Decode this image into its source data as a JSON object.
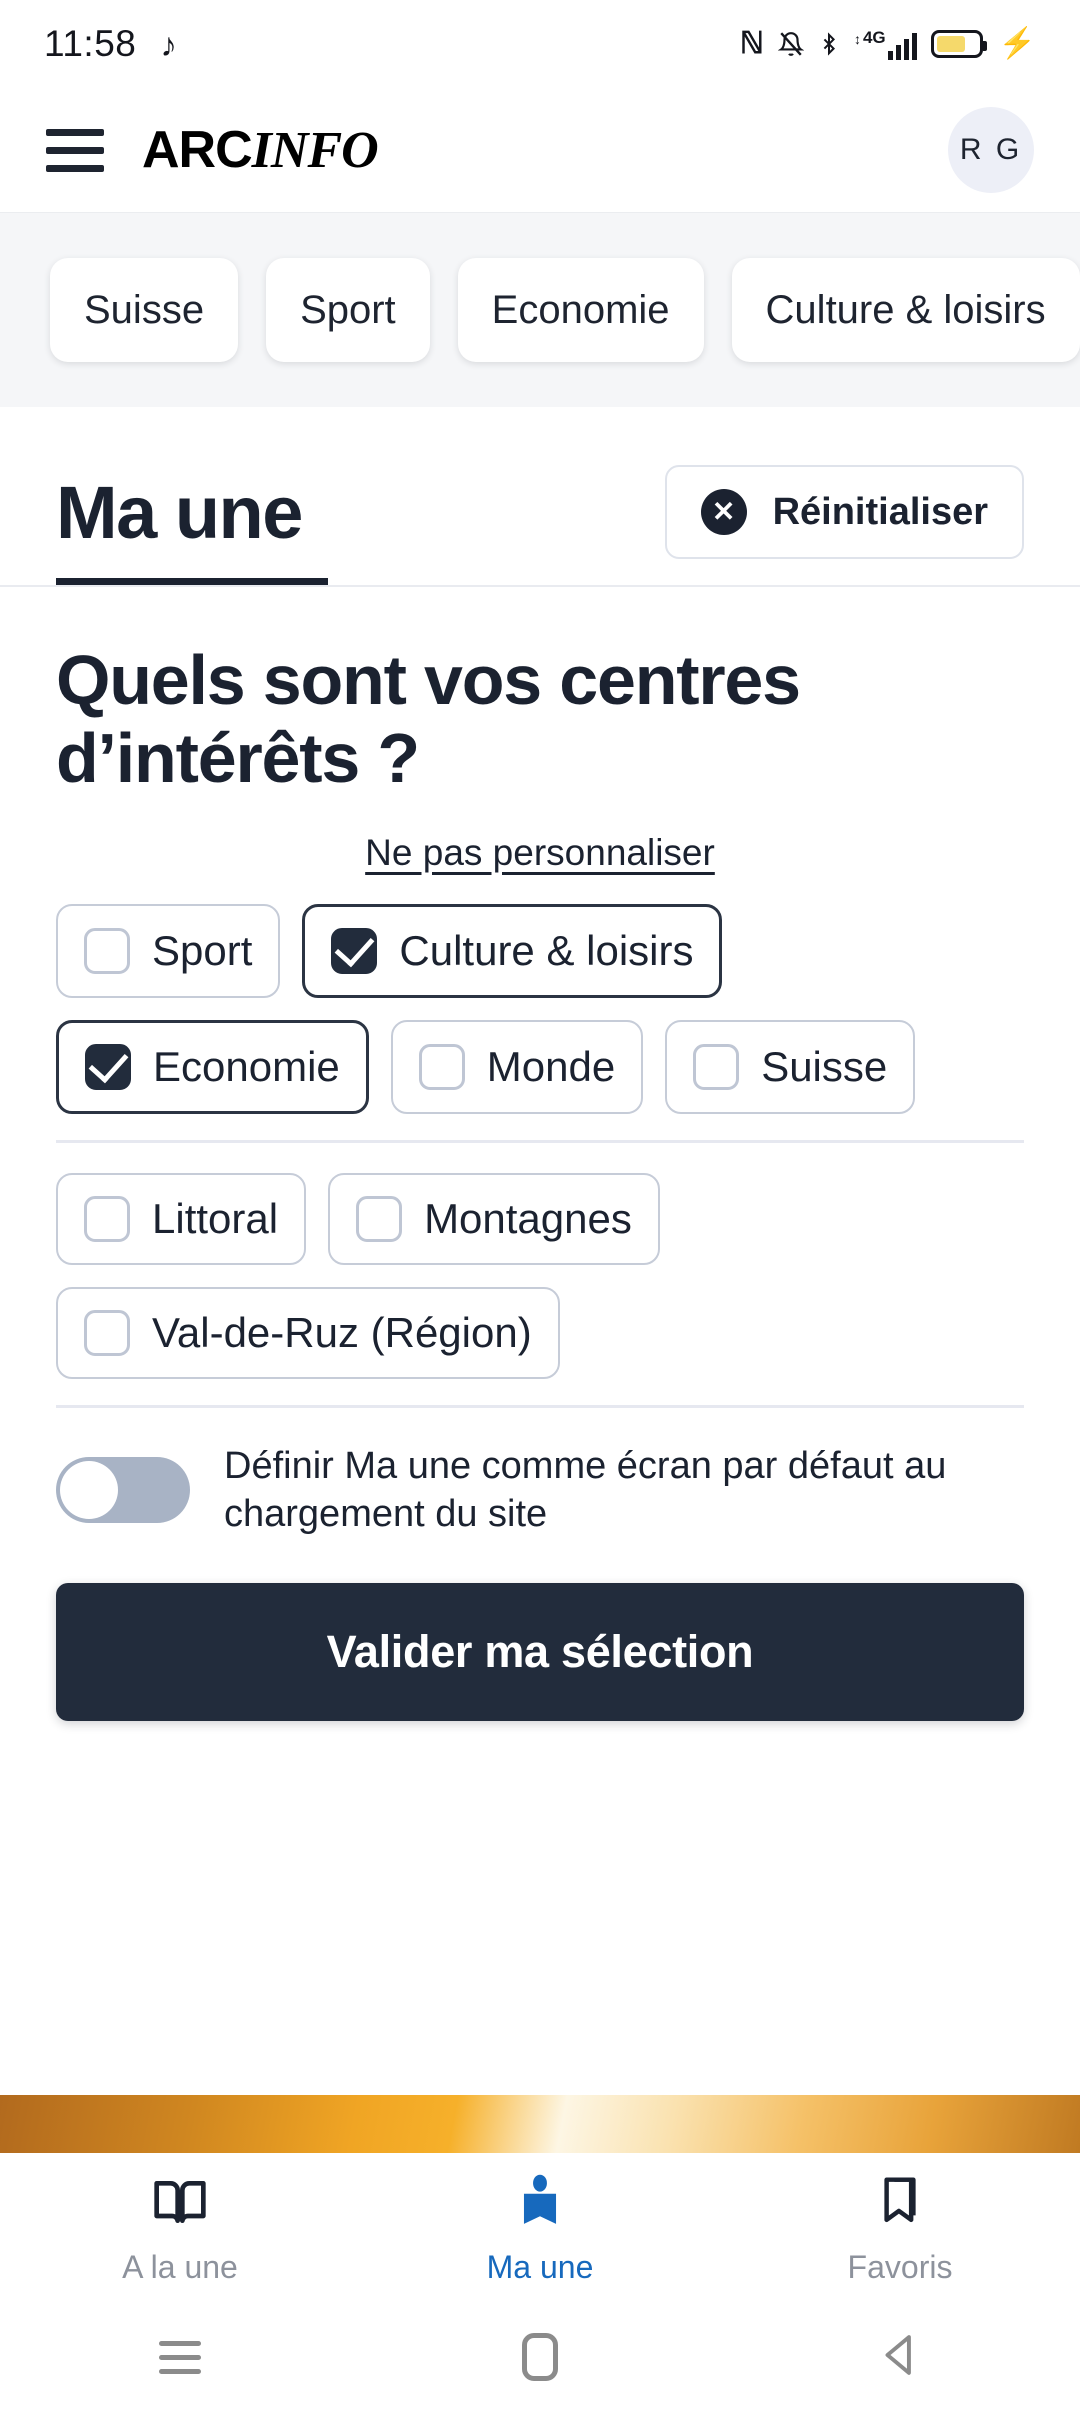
{
  "status_bar": {
    "time": "11:58",
    "music_icon": "music-note-icon",
    "icons": [
      "nfc-icon",
      "notifications-muted-icon",
      "bluetooth-icon",
      "mobile-data-4g-icon",
      "signal-bars-icon",
      "battery-charging-icon"
    ],
    "network_label": "4G",
    "battery_color": "#f5d96b"
  },
  "header": {
    "menu_icon": "hamburger-menu-icon",
    "logo_part1": "ARC",
    "logo_part2": "INFO",
    "avatar_initials": "R G"
  },
  "categories": [
    {
      "label": "Suisse"
    },
    {
      "label": "Sport"
    },
    {
      "label": "Economie"
    },
    {
      "label": "Culture & loisirs"
    }
  ],
  "page": {
    "title": "Ma une",
    "reset_label": "Réinitialiser",
    "reset_icon": "close-circle-icon",
    "heading": "Quels sont vos centres d’intérêts ?",
    "skip_link": "Ne pas personnaliser",
    "toggle_label": "Définir Ma une comme écran par défaut au chargement du site",
    "toggle_state": "off",
    "submit_label": "Valider ma sélection"
  },
  "interest_rows": [
    [
      {
        "label": "Sport",
        "checked": false
      },
      {
        "label": "Culture & loisirs",
        "checked": true
      }
    ],
    [
      {
        "label": "Economie",
        "checked": true
      },
      {
        "label": "Monde",
        "checked": false
      },
      {
        "label": "Suisse",
        "checked": false
      }
    ]
  ],
  "region_rows": [
    [
      {
        "label": "Littoral",
        "checked": false
      },
      {
        "label": "Montagnes",
        "checked": false
      }
    ],
    [
      {
        "label": "Val-de-Ruz (Région)",
        "checked": false
      }
    ]
  ],
  "bottom_nav": [
    {
      "label": "A la une",
      "icon": "open-book-icon",
      "active": false
    },
    {
      "label": "Ma une",
      "icon": "person-book-icon",
      "active": true
    },
    {
      "label": "Favoris",
      "icon": "bookmark-icon",
      "active": false
    }
  ],
  "android_nav": {
    "recents_icon": "recents-icon",
    "home_icon": "home-icon",
    "back_icon": "back-icon"
  },
  "colors": {
    "dark": "#222c3c",
    "accent_blue": "#1769bd",
    "muted": "#8d929c",
    "chip_border": "#c6ccd8"
  }
}
